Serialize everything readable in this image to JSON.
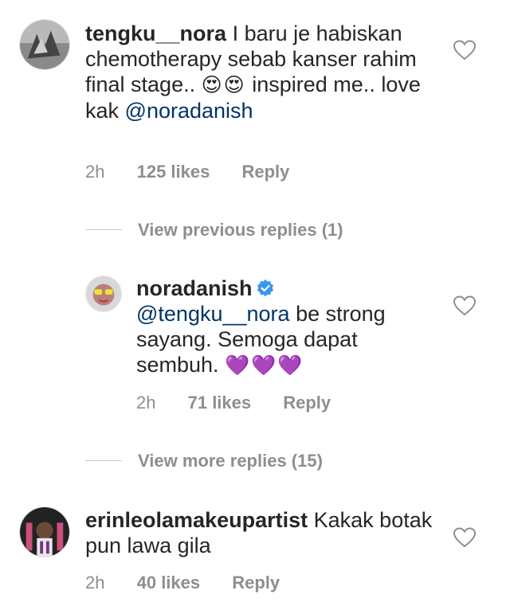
{
  "comments": [
    {
      "username": "tengku__nora",
      "text": "I baru je habiskan chemotherapy sebab kanser rahim final stage..",
      "emojis": "😍😍",
      "text2": "inspired me.. love kak",
      "mention": "@noradanish",
      "time": "2h",
      "likes": "125 likes",
      "reply": "Reply"
    },
    {
      "username": "noradanish",
      "verified": true,
      "mention": "@tengku__nora",
      "text": "be strong sayang. Semoga dapat sembuh.",
      "emojis": "💜💜💜",
      "time": "2h",
      "likes": "71 likes",
      "reply": "Reply"
    },
    {
      "username": "erinleolamakeupartist",
      "text": "Kakak botak pun lawa gila",
      "time": "2h",
      "likes": "40 likes",
      "reply": "Reply"
    }
  ],
  "replies_toggle": {
    "previous": "View previous replies (1)",
    "more": "View more replies (15)"
  },
  "icons": {
    "like": "heart-outline-icon",
    "verified": "verified-badge-icon"
  },
  "colors": {
    "mention": "#003569",
    "muted": "#8e8e8e",
    "verified": "#3897f0"
  }
}
